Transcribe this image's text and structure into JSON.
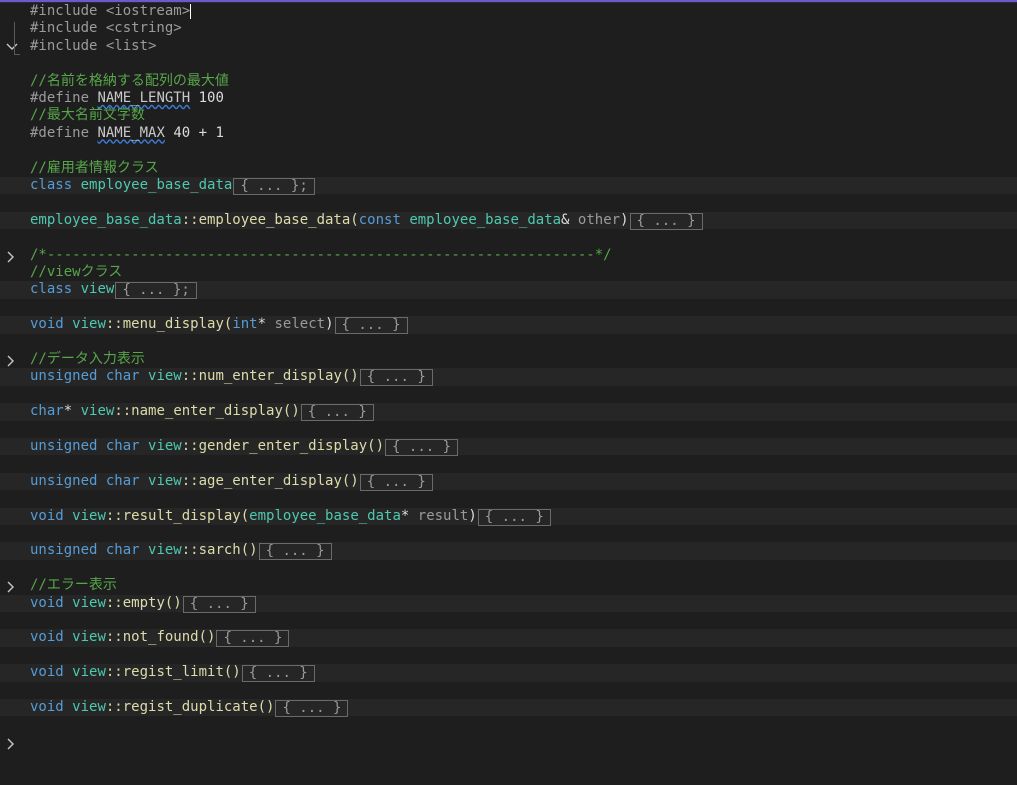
{
  "lines": {
    "l1": {
      "text": "#include <iostream>"
    },
    "l2": {
      "text": "#include <cstring>"
    },
    "l3": {
      "text": "#include <list>"
    },
    "l5": {
      "text": "//名前を格納する配列の最大値"
    },
    "l6": {
      "a": "#define",
      "b": "NAME_LENGTH",
      "c": "100"
    },
    "l7": {
      "text": "//最大名前文字数"
    },
    "l8": {
      "a": "#define",
      "b": "NAME_MAX",
      "c": "40 + 1"
    },
    "l10": {
      "text": "//雇用者情報クラス"
    },
    "l11": {
      "kw": "class",
      "name": "employee_base_data",
      "collapsed": "{ ... };"
    },
    "l13": {
      "type1": "employee_base_data",
      "fn": "::employee_base_data(",
      "kw": "const",
      "type2": "employee_base_data",
      "amp": "&",
      "param": "other",
      "close": ")",
      "collapsed": "{ ... }"
    },
    "l15": {
      "text": "/*-----------------------------------------------------------------*/"
    },
    "l16": {
      "text": "//viewクラス"
    },
    "l17": {
      "kw": "class",
      "name": "view",
      "collapsed": "{ ... };"
    },
    "l19": {
      "kw": "void",
      "type": "view",
      "fn": "::menu_display(",
      "kw2": "int",
      "star": "*",
      "param": "select",
      "close": ")",
      "collapsed": "{ ... }"
    },
    "l21": {
      "text": "//データ入力表示"
    },
    "l22": {
      "kw": "unsigned char",
      "type": "view",
      "fn": "::num_enter_display()",
      "collapsed": "{ ... }"
    },
    "l24": {
      "kw": "char",
      "star": "*",
      "type": "view",
      "fn": "::name_enter_display()",
      "collapsed": "{ ... }"
    },
    "l26": {
      "kw": "unsigned char",
      "type": "view",
      "fn": "::gender_enter_display()",
      "collapsed": "{ ... }"
    },
    "l28": {
      "kw": "unsigned char",
      "type": "view",
      "fn": "::age_enter_display()",
      "collapsed": "{ ... }"
    },
    "l30": {
      "kw": "void",
      "type": "view",
      "fn": "::result_display(",
      "type2": "employee_base_data",
      "star": "*",
      "param": "result",
      "close": ")",
      "collapsed": "{ ... }"
    },
    "l32": {
      "kw": "unsigned char",
      "type": "view",
      "fn": "::sarch()",
      "collapsed": "{ ... }"
    },
    "l34": {
      "text": "//エラー表示"
    },
    "l35": {
      "kw": "void",
      "type": "view",
      "fn": "::empty()",
      "collapsed": "{ ... }"
    },
    "l37": {
      "kw": "void",
      "type": "view",
      "fn": "::not_found()",
      "collapsed": "{ ... }"
    },
    "l39": {
      "kw": "void",
      "type": "view",
      "fn": "::regist_limit()",
      "collapsed": "{ ... }"
    },
    "l41": {
      "kw": "void",
      "type": "view",
      "fn": "::regist_duplicate()",
      "collapsed": "{ ... }"
    }
  },
  "icons": {
    "expanded": "chevron-down-icon",
    "collapsed": "chevron-right-icon"
  },
  "colors": {
    "background": "#1e1e1e",
    "keyword": "#569cd6",
    "type": "#4ec9b0",
    "comment": "#57a64a",
    "accent": "#6a5acd"
  }
}
